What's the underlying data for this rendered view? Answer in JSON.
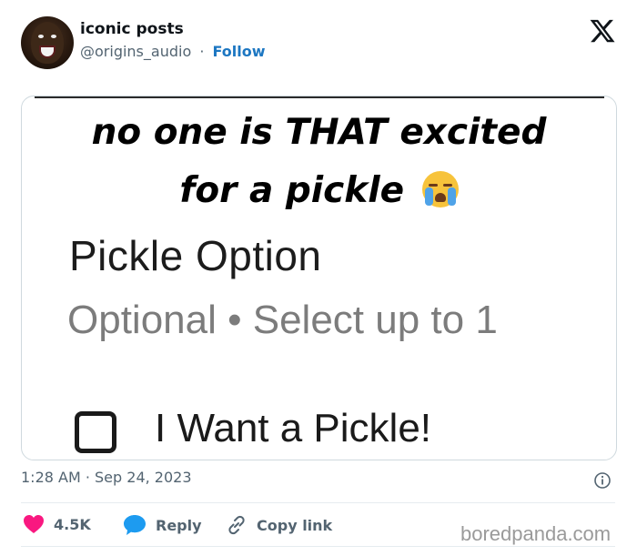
{
  "tweet": {
    "author_name": "iconic posts",
    "handle": "@origins_audio",
    "separator": "·",
    "follow_label": "Follow",
    "timestamp": "1:28 AM · Sep 24, 2023"
  },
  "media": {
    "caption_line1": "no one is THAT excited",
    "caption_line2": "for a pickle",
    "caption_emoji": "loudly-crying-face-emoji",
    "option_title": "Pickle Option",
    "option_subtitle": "Optional • Select up to 1",
    "option_item_label": "I Want a Pickle!",
    "option_item_checked": false
  },
  "actions": {
    "like_count": "4.5K",
    "reply_label": "Reply",
    "copy_link_label": "Copy link"
  },
  "watermark": "boredpanda.com",
  "colors": {
    "follow": "#1d77c2",
    "heart": "#f91880",
    "reply_bubble": "#1d9bf0",
    "meta_text": "#536471"
  },
  "icons": [
    "x-logo-icon",
    "info-icon",
    "heart-icon",
    "reply-icon",
    "link-icon"
  ]
}
